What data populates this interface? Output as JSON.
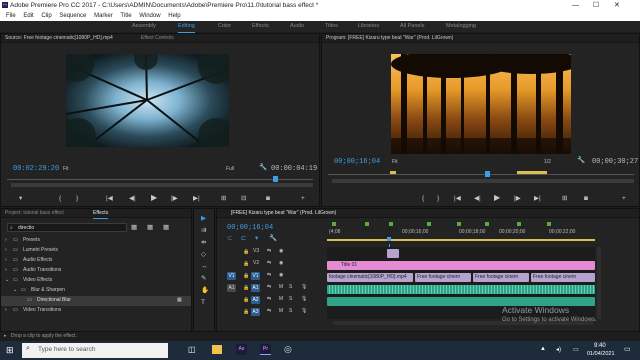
{
  "window": {
    "title": "Adobe Premiere Pro CC 2017 - C:\\Users\\ADMIN\\Documents\\Adobe\\Premiere Pro\\11.0\\tutorial bass effect *",
    "minimize": "—",
    "maximize": "☐",
    "close": "✕"
  },
  "menu": [
    "File",
    "Edit",
    "Clip",
    "Sequence",
    "Marker",
    "Title",
    "Window",
    "Help"
  ],
  "workspaces": [
    "Assembly",
    "Editing",
    "Color",
    "Effects",
    "Audio",
    "Titles",
    "Libraries",
    "All Panels",
    "Metalogging"
  ],
  "source": {
    "tab": "Source: Free footage cinematic[1080P_HD].mp4",
    "tab2": "Effect Controls",
    "timecode_left": "00:02:29:20",
    "fit": "Fit",
    "fit2": "Full",
    "timecode_right": "00:00:04:19"
  },
  "program": {
    "tab": "Program: [FREE] Kizaru type beat \"War\" (Prod. LilGrown)",
    "timecode_left": "00;00;16;04",
    "fit": "Fit",
    "fit2": "1/2",
    "timecode_right": "00;00;30;27"
  },
  "project": {
    "tab": "Project: tutorial bass effect",
    "tab2": "Effects",
    "search": "directio",
    "tree": [
      {
        "label": "Presets",
        "level": 0
      },
      {
        "label": "Lumetri Presets",
        "level": 0
      },
      {
        "label": "Audio Effects",
        "level": 0
      },
      {
        "label": "Audio Transitions",
        "level": 0
      },
      {
        "label": "Video Effects",
        "level": 0
      },
      {
        "label": "Blur & Sharpen",
        "level": 1
      },
      {
        "label": "Directional Blur",
        "level": 2
      },
      {
        "label": "Video Transitions",
        "level": 0
      }
    ]
  },
  "timeline": {
    "tab": "[FREE] Kizaru type beat \"War\" (Prod. LilGrown)",
    "timecode": "00;00;16;04",
    "ruler": [
      "(4;08",
      "00;00;16;00",
      "00;00;18;00",
      "00;00;20;00",
      "00;00;22;00"
    ],
    "tracks": [
      {
        "name": "V3",
        "kind": "video"
      },
      {
        "name": "V2",
        "kind": "video"
      },
      {
        "name": "V1",
        "kind": "video",
        "src": "V1"
      },
      {
        "name": "A1",
        "kind": "audio",
        "src": "A1"
      },
      {
        "name": "A2",
        "kind": "audio"
      },
      {
        "name": "A3",
        "kind": "audio"
      }
    ],
    "clips": {
      "title": "Title 01",
      "v1_clips": [
        "footage cinematic[1080P_HD].mp4",
        "Free footage cinem",
        "Free footage cinem",
        "Free footage cinem"
      ],
      "track_buttons": [
        "M",
        "S"
      ]
    }
  },
  "status": {
    "hint": "Drop a clip to apply the effect."
  },
  "watermark": {
    "title": "Activate Windows",
    "sub": "Go to Settings to activate Windows."
  },
  "taskbar": {
    "search": "Type here to search",
    "time": "9:40",
    "date": "01/04/2021"
  },
  "colors": {
    "accent": "#3d9ee5",
    "video_clip": "#b6a2cf",
    "audio_clip": "#2ea387",
    "title_clip": "#e58bd4"
  }
}
